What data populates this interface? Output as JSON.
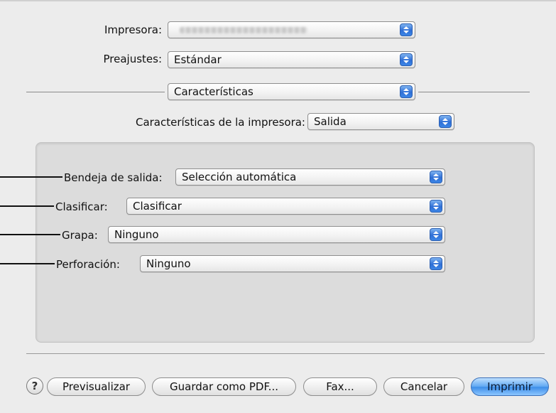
{
  "printer": {
    "label": "Impresora:",
    "value": ""
  },
  "presets": {
    "label": "Preajustes:",
    "value": "Estándar"
  },
  "section": {
    "value": "Características"
  },
  "printer_features": {
    "label": "Características de la impresora:",
    "value": "Salida"
  },
  "options": [
    {
      "label": "Bendeja de salida:",
      "value": "Selección automática"
    },
    {
      "label": "Clasificar:",
      "value": "Clasificar"
    },
    {
      "label": "Grapa:",
      "value": "Ninguno"
    },
    {
      "label": "Perforación:",
      "value": "Ninguno"
    }
  ],
  "buttons": {
    "help": "?",
    "preview": "Previsualizar",
    "save_pdf": "Guardar como PDF...",
    "fax": "Fax...",
    "cancel": "Cancelar",
    "print": "Imprimir"
  },
  "colors": {
    "accent": "#3c8de8",
    "panel": "#dcdcdc",
    "window": "#ececec"
  }
}
